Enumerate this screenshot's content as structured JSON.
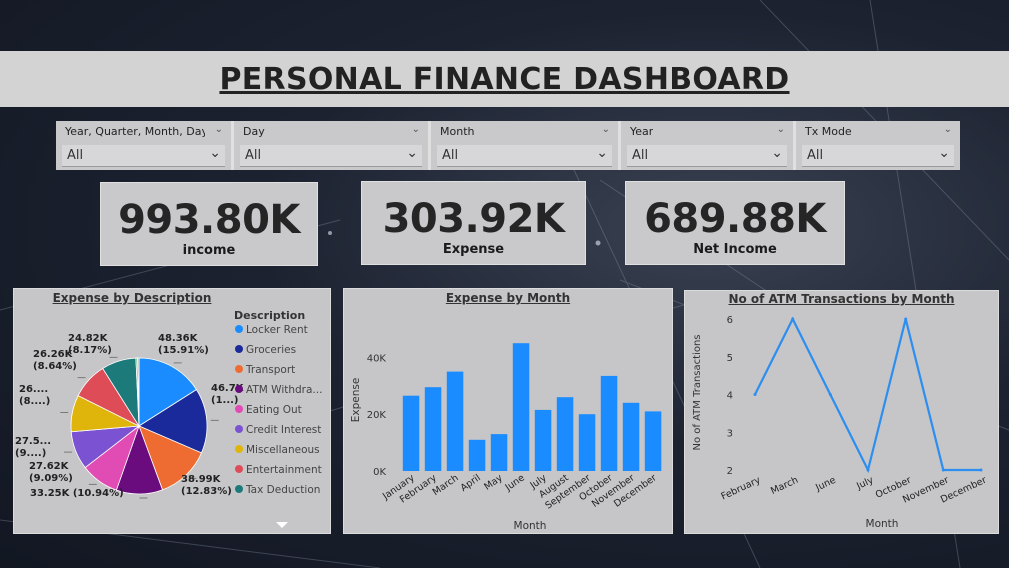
{
  "header": {
    "title": "PERSONAL FINANCE DASHBOARD"
  },
  "slicers": [
    {
      "title": "Year, Quarter, Month, Day,...",
      "value": "All"
    },
    {
      "title": "Day",
      "value": "All"
    },
    {
      "title": "Month",
      "value": "All"
    },
    {
      "title": "Year",
      "value": "All"
    },
    {
      "title": "Tx Mode",
      "value": "All"
    }
  ],
  "kpis": {
    "income": {
      "value": "993.80K",
      "label": "income"
    },
    "expense": {
      "value": "303.92K",
      "label": "Expense"
    },
    "net": {
      "value": "689.88K",
      "label": "Net Income"
    }
  },
  "colors": {
    "bar": "#1a8cff",
    "line": "#2b8ef0",
    "panel": "#c6c6c8"
  },
  "icons": {
    "dropdown": "chevron-down-icon",
    "more": "caret-down-icon"
  },
  "chart_data": [
    {
      "type": "pie",
      "title": "Expense by Description",
      "legend_title": "Description",
      "legend_position": "right",
      "categories": [
        "Locker Rent",
        "Groceries",
        "Transport",
        "ATM Withdra...",
        "Eating Out",
        "Credit Interest",
        "Miscellaneous",
        "Entertainment",
        "Tax Deduction"
      ],
      "legend_colors": [
        "#1a8cff",
        "#1b2a9a",
        "#ee6c32",
        "#6a0b7e",
        "#e14bb4",
        "#7b52d1",
        "#e0b50b",
        "#de4c57",
        "#1d7a7a"
      ],
      "slices": [
        {
          "value": 48.36,
          "label": "48.36K",
          "pct": "(15.91%)",
          "color": "#1a8cff"
        },
        {
          "value": 46.7,
          "label": "46.7K",
          "pct": "(1...)",
          "color": "#1b2a9a"
        },
        {
          "value": 38.99,
          "label": "38.99K",
          "pct": "(12.83%)",
          "color": "#ee6c32"
        },
        {
          "value": 33.25,
          "label": "33.25K (10.94%)",
          "pct": "",
          "color": "#6a0b7e"
        },
        {
          "value": 27.62,
          "label": "27.62K",
          "pct": "(9.09%)",
          "color": "#e14bb4"
        },
        {
          "value": 27.5,
          "label": "27.5...",
          "pct": "(9....)",
          "color": "#7b52d1"
        },
        {
          "value": 26.3,
          "label": "26....",
          "pct": "(8....)",
          "color": "#e0b50b"
        },
        {
          "value": 26.26,
          "label": "26.26K",
          "pct": "(8.64%)",
          "color": "#de4c57"
        },
        {
          "value": 24.82,
          "label": "24.82K",
          "pct": "(8.17%)",
          "color": "#1d7a7a"
        },
        {
          "value": 1.2,
          "label": "",
          "pct": "",
          "color": "#3cb371"
        },
        {
          "value": 1.0,
          "label": "",
          "pct": "",
          "color": "#a0a0a0"
        }
      ]
    },
    {
      "type": "bar",
      "title": "Expense by Month",
      "xlabel": "Month",
      "ylabel": "Expense",
      "ylim": [
        0,
        50000
      ],
      "yticks": [
        {
          "v": 0,
          "t": "0K"
        },
        {
          "v": 20000,
          "t": "20K"
        },
        {
          "v": 40000,
          "t": "40K"
        }
      ],
      "categories": [
        "January",
        "February",
        "March",
        "April",
        "May",
        "June",
        "July",
        "August",
        "September",
        "October",
        "November",
        "December"
      ],
      "values": [
        26500,
        29500,
        35000,
        11000,
        13000,
        45000,
        21500,
        26000,
        20000,
        33500,
        24000,
        21000
      ]
    },
    {
      "type": "line",
      "title": "No of ATM Transactions by Month",
      "xlabel": "Month",
      "ylabel": "No of ATM Transactions",
      "ylim": [
        2,
        6
      ],
      "yticks": [
        2,
        3,
        4,
        5,
        6
      ],
      "categories": [
        "February",
        "March",
        "June",
        "July",
        "October",
        "November",
        "December"
      ],
      "values": [
        4,
        6,
        4,
        2,
        6,
        2,
        2
      ]
    }
  ]
}
